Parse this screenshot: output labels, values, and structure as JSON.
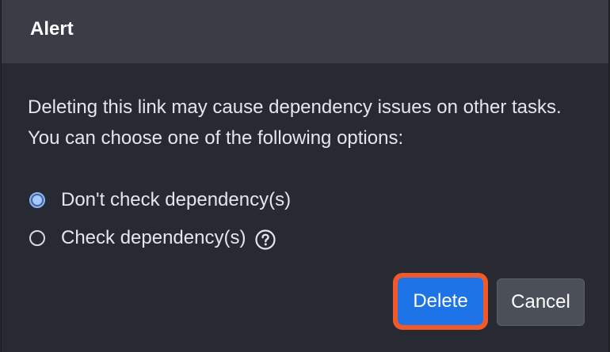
{
  "dialog": {
    "title": "Alert",
    "message": "Deleting this link may cause dependency issues on other tasks. You can choose one of the following options:",
    "options": [
      {
        "label": "Don't check dependency(s)",
        "checked": true
      },
      {
        "label": "Check dependency(s)",
        "checked": false,
        "help_icon": "question-circle-icon"
      }
    ],
    "buttons": {
      "delete_label": "Delete",
      "cancel_label": "Cancel"
    },
    "colors": {
      "primary": "#1e74e6",
      "highlight": "#f0592a",
      "header_bg": "#3a3d45",
      "body_bg": "#272a32"
    }
  }
}
